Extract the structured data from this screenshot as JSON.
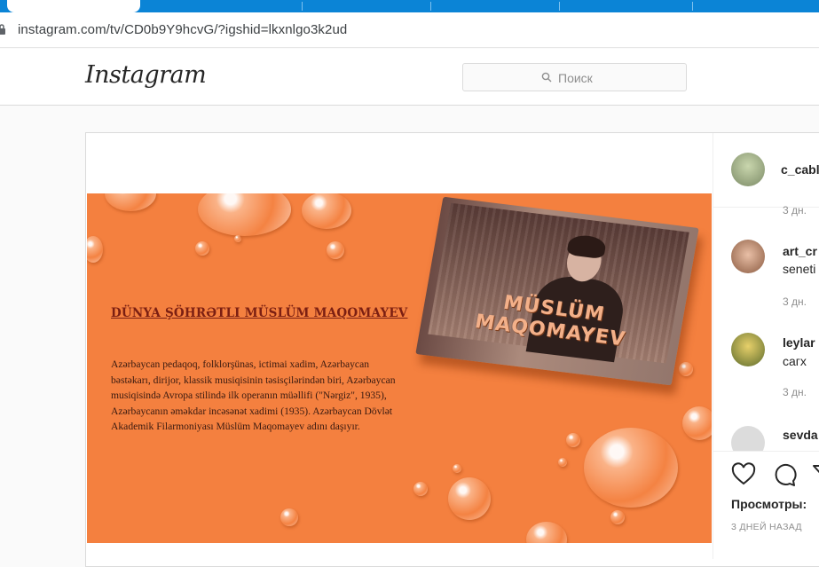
{
  "browser": {
    "url": "instagram.com/tv/CD0b9Y9hcvG/?igshid=lkxnlgo3k2ud"
  },
  "header": {
    "logo": "Instagram",
    "search_placeholder": "Поиск"
  },
  "post": {
    "slide_title": "DÜNYA ŞÖHRƏTLI MÜSLÜM MAQOMAYEV",
    "slide_text": "Azərbaycan pedaqoq, folklorşünas, ictimai xadim, Azərbaycan bəstəkarı, dirijor, klassik musiqisinin təsisçilərindən biri, Azərbaycan musiqisində Avropa stilində ilk operanın müəllifi (\"Nərgiz\", 1935), Azərbaycanın əməkdar incəsənət xadimi (1935). Azərbaycan Dövlət Akademik Filarmoniyası Müslüm Maqomayev adını daşıyır.",
    "photo_caption": "MÜSLÜM MAQOMAYEV",
    "owner_username": "c_cabl",
    "comments": [
      {
        "time": "3 дн."
      },
      {
        "username": "art_cr",
        "text": "seneti",
        "time": "3 дн."
      },
      {
        "username": "leylar",
        "text": "сагх",
        "time": "3 дн."
      },
      {
        "username": "sevda"
      }
    ],
    "views_label": "Просмотры:",
    "posted_ago": "3 ДНЕЙ НАЗАД"
  },
  "colors": {
    "slide_background": "#f4803f",
    "instagram_text": "#262626",
    "secondary_text": "#8e8e8e"
  }
}
